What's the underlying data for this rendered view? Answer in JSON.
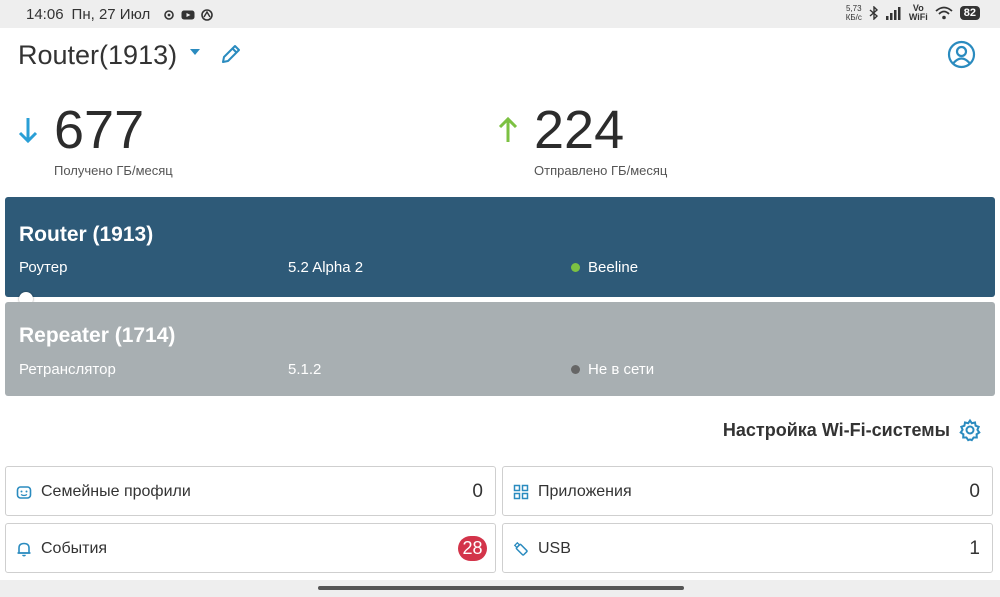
{
  "status_bar": {
    "time": "14:06",
    "date": "Пн, 27 Июл",
    "speed_value": "5,73",
    "speed_unit": "КБ/с",
    "vowifi_top": "Vo",
    "vowifi_bottom": "WiFi",
    "battery": "82",
    "left_icons": [
      "settings-icon",
      "youtube-icon",
      "app-icon"
    ],
    "right_icons": [
      "bluetooth-icon",
      "signal-icon",
      "wifi-icon",
      "battery-icon"
    ]
  },
  "header": {
    "title": "Router(1913)",
    "icons": [
      "dropdown-arrow-icon",
      "pencil-icon",
      "account-icon"
    ]
  },
  "stats": {
    "received": {
      "value": "677",
      "label": "Получено ГБ/месяц",
      "icon": "arrow-down-icon",
      "color": "#2a9fd6"
    },
    "sent": {
      "value": "224",
      "label": "Отправлено ГБ/месяц",
      "icon": "arrow-up-icon",
      "color": "#7cc142"
    }
  },
  "devices": [
    {
      "name": "Router (1913)",
      "type": "Роутер",
      "version": "5.2 Alpha 2",
      "status": "Beeline",
      "status_color": "#7cc142",
      "bg": "#2e5a78"
    },
    {
      "name": "Repeater (1714)",
      "type": "Ретранслятор",
      "version": "5.1.2",
      "status": "Не в сети",
      "status_color": "#666666",
      "bg": "#a8afb2"
    }
  ],
  "wifi_settings": {
    "label": "Настройка Wi-Fi-системы",
    "icon": "gear-icon"
  },
  "tiles": {
    "family": {
      "label": "Семейные профили",
      "count": "0",
      "icon": "family-icon"
    },
    "apps": {
      "label": "Приложения",
      "count": "0",
      "icon": "grid-icon"
    },
    "events": {
      "label": "События",
      "count": "28",
      "icon": "bell-icon"
    },
    "usb": {
      "label": "USB",
      "count": "1",
      "icon": "usb-icon"
    }
  },
  "colors": {
    "accent": "#2a8bbf",
    "badge": "#d3344a"
  }
}
